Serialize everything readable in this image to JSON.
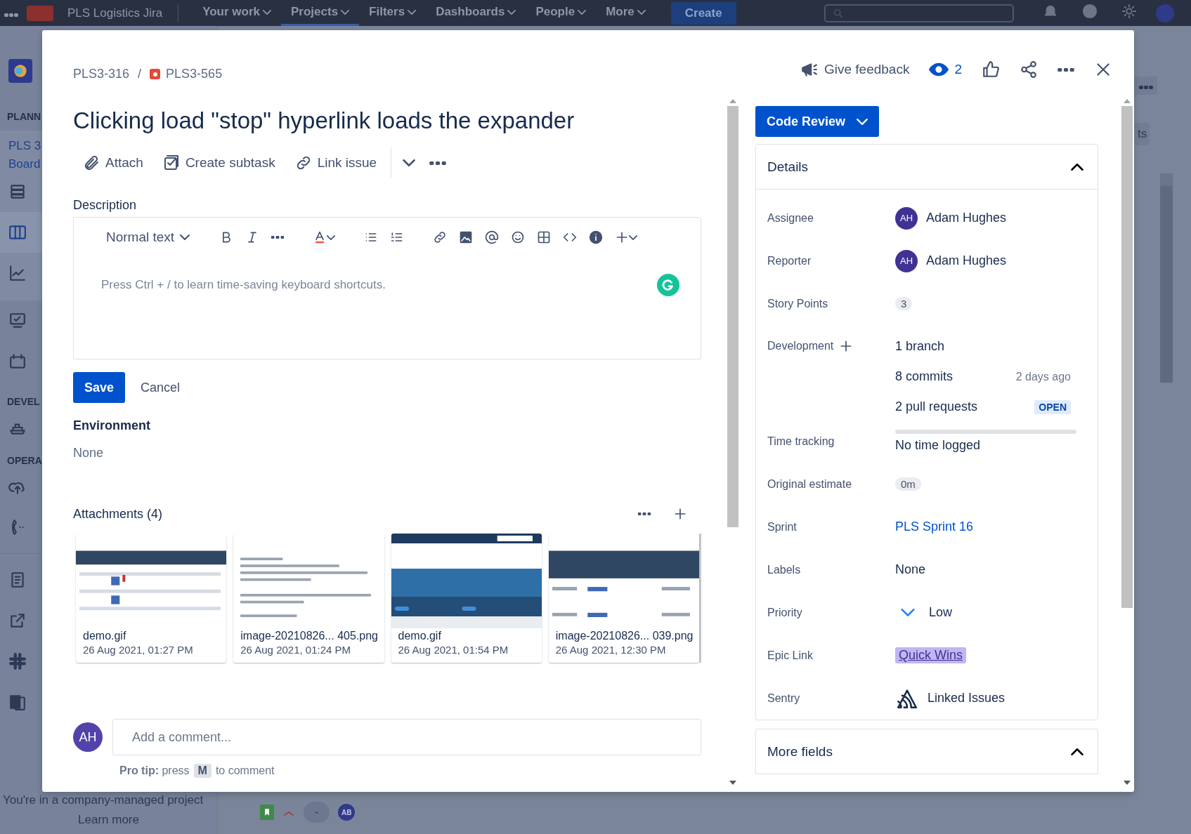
{
  "background": {
    "top_nav": {
      "app_name": "PLS Logistics Jira",
      "items": [
        {
          "label": "Your work",
          "selected": false
        },
        {
          "label": "Projects",
          "selected": true
        },
        {
          "label": "Filters",
          "selected": false
        },
        {
          "label": "Dashboards",
          "selected": false
        },
        {
          "label": "People",
          "selected": false
        },
        {
          "label": "More",
          "selected": false
        }
      ],
      "create": "Create"
    },
    "sidebar": {
      "planning_heading": "PLANN",
      "project_name": "PLS 3",
      "board_label": "Board",
      "development_heading": "DEVEL",
      "operations_heading": "OPERA",
      "footer_text": "You're in a company-managed project",
      "learn_more": "Learn more"
    },
    "card": {
      "estimate": "-",
      "avatar": "AB"
    },
    "right_edge_label": "ts"
  },
  "modal": {
    "breadcrumbs": [
      {
        "label": "PLS3-316",
        "kind": "parent"
      },
      {
        "label": "PLS3-565",
        "kind": "bug"
      }
    ],
    "separator": "/",
    "feedback": "Give feedback",
    "watchers": "2",
    "title": "Clicking load \"stop\" hyperlink loads the expander",
    "actions": [
      {
        "label": "Attach",
        "kind": "attach"
      },
      {
        "label": "Create subtask",
        "kind": "subtask"
      },
      {
        "label": "Link issue",
        "kind": "link"
      }
    ],
    "description": {
      "label": "Description",
      "text_style": "Normal text",
      "placeholder": "Press Ctrl + / to learn time-saving keyboard shortcuts."
    },
    "save": "Save",
    "cancel": "Cancel",
    "environment": {
      "label": "Environment",
      "value": "None"
    },
    "attachments": {
      "title": "Attachments (4)",
      "items": [
        {
          "name": "demo.gif",
          "date": "26 Aug 2021, 01:27 PM",
          "kind": "picture"
        },
        {
          "name": "image-20210826... 405.png",
          "date": "26 Aug 2021, 01:24 PM",
          "kind": "picture"
        },
        {
          "name": "demo.gif",
          "date": "26 Aug 2021, 01:54 PM",
          "kind": "picture"
        },
        {
          "name": "image-20210826... 039.png",
          "date": "26 Aug 2021, 12:30 PM",
          "kind": "picture"
        }
      ]
    },
    "comment": {
      "avatar": "AH",
      "placeholder": "Add a comment...",
      "tip": "**Pro tip:** press",
      "key": "M",
      "tip_after": "to comment"
    },
    "status": "Code Review",
    "details": {
      "title": "Details",
      "expanded": true,
      "fields": [
        {
          "kind": "user",
          "label": "Assignee",
          "avatar": "AH",
          "value": "Adam Hughes"
        },
        {
          "kind": "user",
          "label": "Reporter",
          "avatar": "AH",
          "value": "Adam Hughes"
        },
        {
          "kind": "badge",
          "label": "Story Points",
          "value": "3"
        },
        {
          "kind": "development",
          "label": "Development",
          "items": [
            {
              "count": "1",
              "text": "branch"
            },
            {
              "count": "8",
              "text": "commits",
              "meta": "2 days ago"
            },
            {
              "count": "2",
              "text": "pull requests",
              "lozenge": "OPEN"
            }
          ]
        },
        {
          "kind": "time",
          "label": "Time tracking",
          "level": 0,
          "value": "No time logged"
        },
        {
          "kind": "badge",
          "label": "Original estimate",
          "value": "0m"
        },
        {
          "kind": "link",
          "label": "Sprint",
          "value": "PLS Sprint 16"
        },
        {
          "kind": "text",
          "label": "Labels",
          "value": "None"
        },
        {
          "kind": "priority",
          "label": "Priority",
          "value": "Low"
        },
        {
          "kind": "epic",
          "label": "Epic Link",
          "value": "Quick Wins"
        },
        {
          "kind": "sentry",
          "label": "Sentry",
          "value": "Linked Issues"
        }
      ]
    },
    "more_fields": {
      "title": "More fields",
      "expanded": true
    }
  }
}
